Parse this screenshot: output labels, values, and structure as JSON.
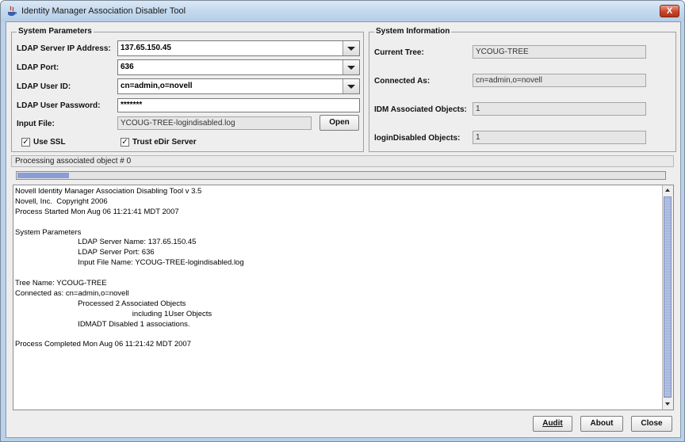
{
  "window": {
    "title": "Identity Manager Association Disabler Tool",
    "close_glyph": "X"
  },
  "system_parameters": {
    "title": "System Parameters",
    "ldap_server_ip": {
      "label": "LDAP Server IP Address:",
      "value": "137.65.150.45"
    },
    "ldap_port": {
      "label": "LDAP Port:",
      "value": "636"
    },
    "ldap_user_id": {
      "label": "LDAP User ID:",
      "value": "cn=admin,o=novell"
    },
    "ldap_user_password": {
      "label": "LDAP User Password:",
      "value": "*******"
    },
    "input_file": {
      "label": "Input File:",
      "value": "YCOUG-TREE-logindisabled.log",
      "open_button": "Open"
    },
    "use_ssl": {
      "label": "Use SSL",
      "checked": true
    },
    "trust_edir": {
      "label": "Trust eDir Server",
      "checked": true
    }
  },
  "system_information": {
    "title": "System Information",
    "current_tree": {
      "label": "Current Tree:",
      "value": "YCOUG-TREE"
    },
    "connected_as": {
      "label": "Connected As:",
      "value": "cn=admin,o=novell"
    },
    "idm_associated": {
      "label": "IDM Associated Objects:",
      "value": "1"
    },
    "login_disabled": {
      "label": "loginDisabled Objects:",
      "value": "1"
    }
  },
  "status": {
    "text": "Processing associated object # 0",
    "progress_percent": 8
  },
  "log": {
    "lines": [
      "Novell Identity Manager Association Disabling Tool v 3.5",
      "Novell, Inc.  Copyright 2006",
      "Process Started Mon Aug 06 11:21:41 MDT 2007",
      "",
      "System Parameters",
      "                              LDAP Server Name: 137.65.150.45",
      "                              LDAP Server Port: 636",
      "                              Input File Name: YCOUG-TREE-logindisabled.log",
      "",
      "Tree Name: YCOUG-TREE",
      "Connected as: cn=admin,o=novell",
      "                              Processed 2 Associated Objects",
      "                                                        including 1User Objects",
      "                              IDMADT Disabled 1 associations.",
      "",
      "Process Completed Mon Aug 06 11:21:42 MDT 2007"
    ]
  },
  "buttons": {
    "audit": "Audit",
    "about": "About",
    "close": "Close"
  },
  "colors": {
    "title_bar": "#c4d9ee",
    "progress_fill": "#8a9ed6",
    "close_button": "#c9452a"
  }
}
